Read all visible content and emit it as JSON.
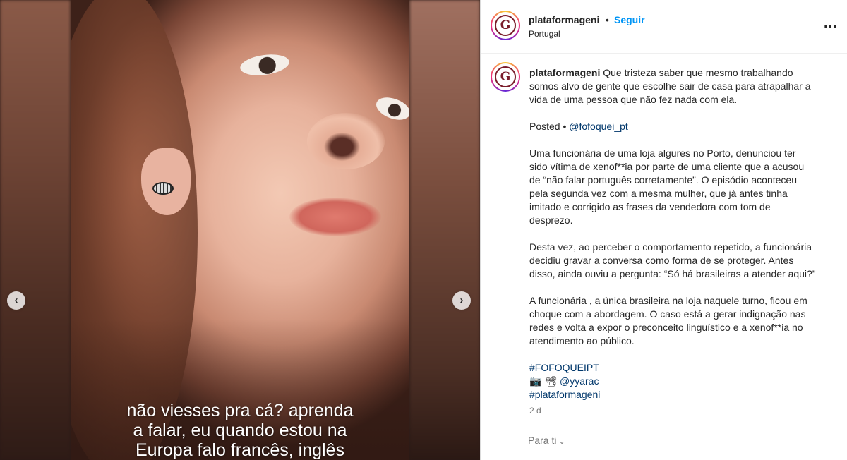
{
  "post": {
    "username": "plataformageni",
    "follow_label": "Seguir",
    "separator": "•",
    "location": "Portugal",
    "more_label": "...",
    "avatar_letter": "G"
  },
  "media": {
    "caption_lines": [
      "não viesses pra cá? aprenda",
      "a falar, eu quando estou na",
      "Europa falo francês, inglês"
    ],
    "prev_label": "‹",
    "next_label": "›"
  },
  "caption": {
    "username": "plataformageni",
    "intro_lines": [
      "Que tristeza saber que mesmo trabalhando",
      "somos alvo de gente que escolhe sair de casa para atrapalhar a",
      "vida de uma pessoa que não fez nada com ela."
    ],
    "posted_label": "Posted •",
    "posted_mention": "@fofoquei_pt",
    "paragraph1": [
      "Uma funcionária de uma loja algures no Porto, denunciou ter",
      "sido vítima de xenof**ia por parte de uma cliente que a acusou",
      "de “não falar português corretamente”. O episódio aconteceu",
      "pela segunda vez com a mesma mulher, que já antes tinha",
      "imitado e corrigido as frases da vendedora com tom de",
      "desprezo."
    ],
    "paragraph2": [
      "Desta vez, ao perceber o comportamento repetido, a funcionária",
      "decidiu gravar a conversa como forma de se proteger. Antes",
      "disso, ainda ouviu a pergunta: “Só há brasileiras a atender aqui?”"
    ],
    "paragraph3": [
      "A funcionária , a única brasileira na loja naquele turno, ficou em",
      "choque com a abordagem. O caso está a gerar indignação nas",
      "redes e volta a expor o preconceito linguístico e a xenof**ia no",
      "atendimento ao público."
    ],
    "hashtag1": "#FOFOQUEIPT",
    "credit_icons": "📷 📽",
    "credit_mention": "@yyarac",
    "hashtag2": "#plataformageni",
    "time": "2 d"
  },
  "footer": {
    "see_translation": "Para ti",
    "chevron": "⌄"
  }
}
